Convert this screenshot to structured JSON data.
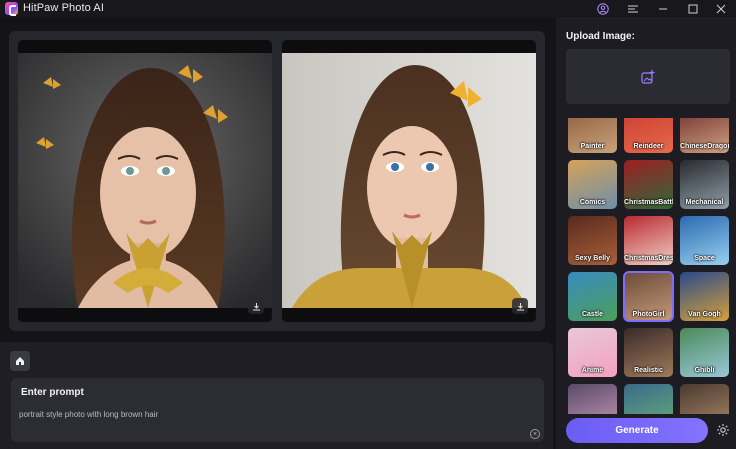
{
  "window": {
    "title": "HitPaw Photo AI",
    "icons": [
      "account-icon",
      "menu-icon",
      "minimize-icon",
      "maximize-icon",
      "close-icon"
    ]
  },
  "workspace": {
    "images": [
      {
        "name": "original-image",
        "download_icon": "download-icon"
      },
      {
        "name": "generated-image",
        "download_icon": "download-icon"
      }
    ],
    "home_icon": "home-icon"
  },
  "prompt": {
    "title": "Enter prompt",
    "value": "portrait style photo with long brown hair",
    "clear_icon": "clear-icon"
  },
  "sidebar": {
    "upload_title": "Upload Image:",
    "upload_icon": "add-image-icon",
    "styles": [
      {
        "label": "Painter",
        "colors": [
          "#8a5a3a",
          "#c9a27a"
        ]
      },
      {
        "label": "Reindeer",
        "colors": [
          "#c7392f",
          "#e86a4a"
        ]
      },
      {
        "label": "ChineseDragon",
        "colors": [
          "#6b2a2a",
          "#d0a080"
        ]
      },
      {
        "label": "Comics",
        "colors": [
          "#d3a35a",
          "#6f8fa8"
        ]
      },
      {
        "label": "ChristmasBattle",
        "colors": [
          "#9d1e22",
          "#2f6a3a"
        ]
      },
      {
        "label": "Mechanical",
        "colors": [
          "#2a2a30",
          "#8fa0a8"
        ]
      },
      {
        "label": "Sexy Belly",
        "colors": [
          "#5a2a1e",
          "#a8603a"
        ]
      },
      {
        "label": "ChristmasDress",
        "colors": [
          "#b82a30",
          "#f2d0c8"
        ]
      },
      {
        "label": "Space",
        "colors": [
          "#2a6ab0",
          "#9ad0f0"
        ]
      },
      {
        "label": "Castle",
        "colors": [
          "#3a8ac0",
          "#4aa05a"
        ]
      },
      {
        "label": "PhotoGirl",
        "colors": [
          "#6a4a3a",
          "#c89a78"
        ]
      },
      {
        "label": "Van Gogh",
        "colors": [
          "#2a4a8a",
          "#d6a03a"
        ]
      },
      {
        "label": "Anime",
        "colors": [
          "#e8c8d8",
          "#f4a0c0"
        ]
      },
      {
        "label": "Realistic",
        "colors": [
          "#3a2a2a",
          "#a07a5a"
        ]
      },
      {
        "label": "Ghibli",
        "colors": [
          "#4a8a5a",
          "#9ac8d8"
        ]
      },
      {
        "label": "",
        "colors": [
          "#5a4a6a",
          "#c89ab8"
        ]
      },
      {
        "label": "",
        "colors": [
          "#3a6a8a",
          "#6ab07a"
        ]
      },
      {
        "label": "",
        "colors": [
          "#4a3a30",
          "#b08a6a"
        ]
      }
    ],
    "selected_style": "PhotoGirl",
    "generate_label": "Generate",
    "settings_icon": "settings-icon"
  }
}
